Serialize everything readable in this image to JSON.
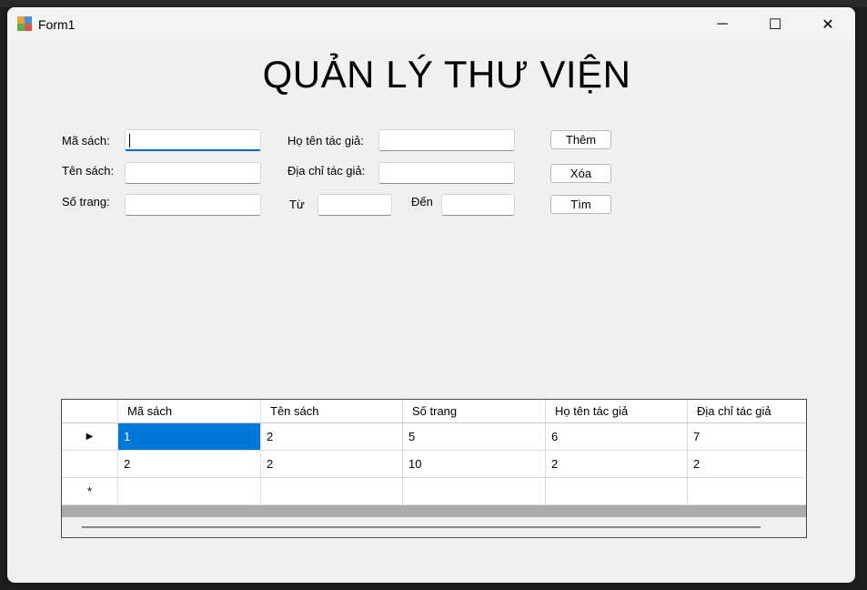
{
  "window": {
    "title": "Form1",
    "controls": {
      "minimize": "─",
      "maximize": "☐",
      "close": "✕"
    }
  },
  "form": {
    "heading": "QUẢN LÝ THƯ VIỆN",
    "labels": {
      "ma_sach": "Mã sách:",
      "ten_sach": "Tên sách:",
      "so_trang": "Số trang:",
      "ho_ten_tac_gia": "Họ tên tác giả:",
      "dia_chi_tac_gia": "Địa chỉ tác giả:",
      "tu": "Từ",
      "den": "Đến"
    },
    "inputs": {
      "ma_sach": "",
      "ten_sach": "",
      "so_trang": "",
      "ho_ten_tac_gia": "",
      "dia_chi_tac_gia": "",
      "tu": "",
      "den": ""
    },
    "buttons": {
      "them": "Thêm",
      "xoa": "Xóa",
      "tim": "Tìm"
    }
  },
  "grid": {
    "columns": [
      "Mã sách",
      "Tên sách",
      "Số trang",
      "Họ tên tác giả",
      "Địa chỉ tác giả"
    ],
    "rows": [
      [
        "1",
        "2",
        "5",
        "6",
        "7"
      ],
      [
        "2",
        "2",
        "10",
        "2",
        "2"
      ]
    ],
    "row_headers": {
      "current": "▶",
      "new": "*"
    },
    "selected_color": "#0078d7"
  }
}
